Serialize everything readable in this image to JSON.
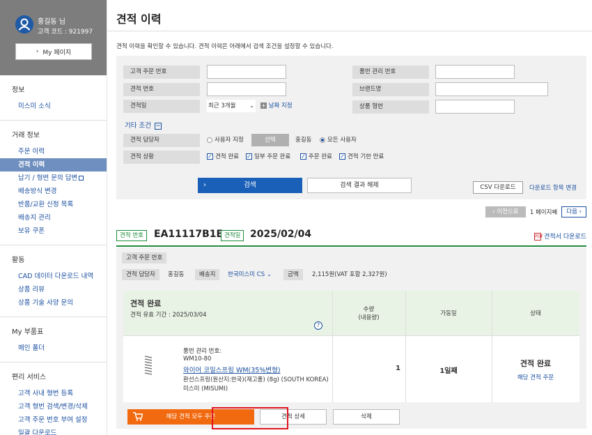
{
  "user": {
    "name": "홍길동 님",
    "code": "고객 코드 : 921997",
    "mypage_label": "My 페이지"
  },
  "sidebar": {
    "sections": [
      {
        "title": "정보",
        "items": [
          "미스미 소식"
        ]
      },
      {
        "title": "거래 정보",
        "items": [
          "주문 이력",
          "견적 이력",
          "납기 / 형번 문의 답변",
          "배송방식 변경",
          "반품/교환 신청 목록",
          "배송지 관리",
          "보유 쿠폰"
        ]
      },
      {
        "title": "활동",
        "items": [
          "CAD 데이터 다운로드 내역",
          "상품 리뷰",
          "상품 기술 사양 문의"
        ]
      },
      {
        "title": "My 부품표",
        "items": [
          "메인 폴더"
        ]
      },
      {
        "title": "편리 서비스",
        "items": [
          "고객 사내 형번 등록",
          "고객 형번 검색/변경/삭제",
          "고객 주문 번호 부여 설정",
          "일괄 다운로드"
        ]
      }
    ]
  },
  "page": {
    "title": "견적 이력",
    "intro": "견적 이력을 확인할 수 있습니다. 견적 이력은 아래에서 검색 조건을 설정할 수 있습니다."
  },
  "search": {
    "customer_order_no": "고객 주문 번호",
    "part_mgmt_no": "품번 관리 번호",
    "estimate_no": "견적 번호",
    "brand_name": "브랜드명",
    "estimate_date": "견적일",
    "period_selected": "최근 3개월",
    "date_specify": "날짜 지정",
    "product_model": "상품 형번",
    "other_conditions": "기타 조건",
    "person_in_charge": "견적 담당자",
    "user_specify": "사용자 지정",
    "select_label": "선택",
    "current_user": "홍길동",
    "all_users": "모든 사용자",
    "status_label": "견적 상황",
    "status_options": [
      "견적 완료",
      "일부 주문 완료",
      "주문 완료",
      "견적 기한 만료"
    ],
    "search_button": "검색",
    "reset_button": "검색 결과 해제",
    "csv_button": "CSV 다운로드",
    "csv_item_change": "다운로드 항목 변경"
  },
  "pager": {
    "prev": "이전으로",
    "current": "1 페이지째",
    "next": "다음"
  },
  "estimate": {
    "no_tag": "견적 번호",
    "no": "EA11117B1E",
    "date_tag": "견적일",
    "date": "2025/02/04",
    "pdf_download": "견적서 다운로드",
    "customer_order_label": "고객 주문 번호",
    "person_label": "견적 담당자",
    "person": "홍길동",
    "ship_label": "배송지",
    "ship_value": "한국미스미 CS",
    "amount_label": "금액",
    "amount": "2,115원(VAT 포함 2,327원)",
    "status_title": "견적 완료",
    "validity": "견적 유효 기간 : 2025/03/04",
    "col_qty": "수량",
    "col_qty_sub": "(내용량)",
    "col_days": "가동일",
    "col_status": "상태",
    "item": {
      "part_label": "품번 관리 번호:",
      "model": "WM10-80",
      "name": "와이어 코일스프링 WM(35%변형)",
      "desc": "환선스프링(원산지:한국)(재고품) (8g) (SOUTH KOREA)",
      "maker": "미스미 (MISUMI)",
      "qty": "1",
      "days": "1일째",
      "status": "견적 완료",
      "order_link": "해당 견적 주문"
    },
    "cart_all": "해당 견적 모두 주문",
    "detail": "견적 상세",
    "delete": "삭제"
  },
  "colors": {
    "accent": "#1a5fb8",
    "green": "#1e8a3a",
    "orange": "#f26a10",
    "highlight": "#e0141e"
  }
}
